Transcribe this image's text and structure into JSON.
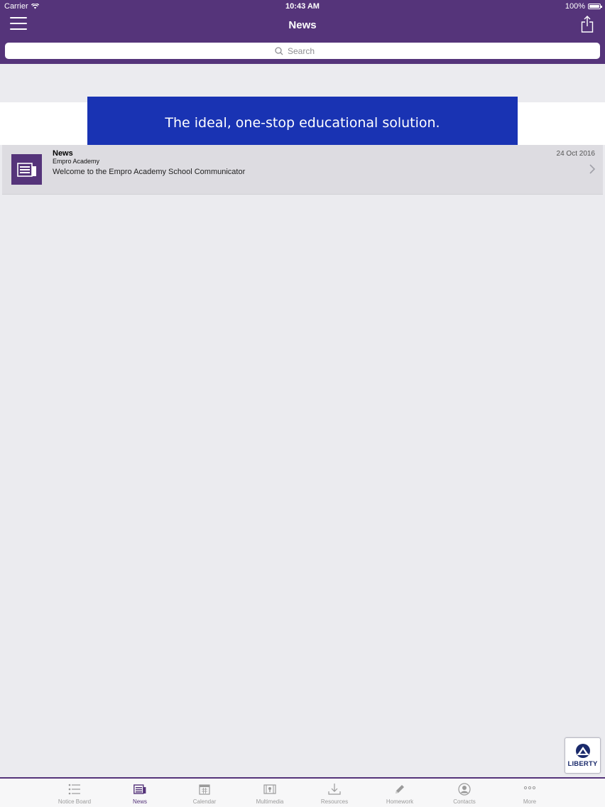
{
  "status_bar": {
    "carrier": "Carrier",
    "time": "10:43 AM",
    "battery": "100%"
  },
  "nav": {
    "title": "News"
  },
  "search": {
    "placeholder": "Search"
  },
  "banner": {
    "text": "The ideal, one-stop educational solution."
  },
  "news_items": [
    {
      "title": "News",
      "subtitle": "Empro Academy",
      "body": "Welcome to the Empro Academy School Communicator",
      "date": "24 Oct 2016"
    }
  ],
  "badge": {
    "label": "LIBERTY"
  },
  "tabs": [
    {
      "label": "Notice Board",
      "icon": "list-icon",
      "active": false
    },
    {
      "label": "News",
      "icon": "newspaper-icon",
      "active": true
    },
    {
      "label": "Calendar",
      "icon": "calendar-icon",
      "active": false
    },
    {
      "label": "Multimedia",
      "icon": "film-icon",
      "active": false
    },
    {
      "label": "Resources",
      "icon": "download-icon",
      "active": false
    },
    {
      "label": "Homework",
      "icon": "pencil-icon",
      "active": false
    },
    {
      "label": "Contacts",
      "icon": "person-icon",
      "active": false
    },
    {
      "label": "More",
      "icon": "more-icon",
      "active": false
    }
  ],
  "colors": {
    "brand": "#55347a",
    "banner": "#1933b3",
    "background": "#ebebef"
  }
}
